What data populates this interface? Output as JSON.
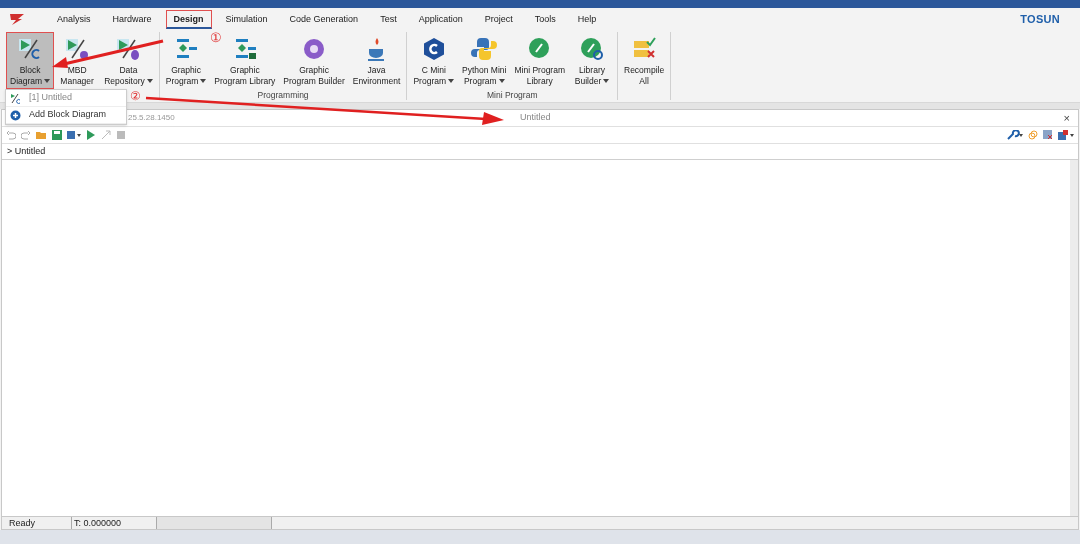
{
  "menu_tabs": [
    {
      "label": "Analysis",
      "selected": false,
      "highlighted": false
    },
    {
      "label": "Hardware",
      "selected": false,
      "highlighted": false
    },
    {
      "label": "Design",
      "selected": true,
      "highlighted": true
    },
    {
      "label": "Simulation",
      "selected": false,
      "highlighted": false
    },
    {
      "label": "Code Generation",
      "selected": false,
      "highlighted": false
    },
    {
      "label": "Test",
      "selected": false,
      "highlighted": false
    },
    {
      "label": "Application",
      "selected": false,
      "highlighted": false
    },
    {
      "label": "Project",
      "selected": false,
      "highlighted": false
    },
    {
      "label": "Tools",
      "selected": false,
      "highlighted": false
    },
    {
      "label": "Help",
      "selected": false,
      "highlighted": false
    }
  ],
  "brand": "TOSUN",
  "ribbon_groups": [
    {
      "items": [
        {
          "kind": "block",
          "lines": [
            "Block",
            "Diagram"
          ],
          "dropdown": true,
          "pressed": true
        },
        {
          "kind": "mbd",
          "lines": [
            "MBD",
            "Manager"
          ],
          "dropdown": false,
          "pressed": false
        },
        {
          "kind": "data",
          "lines": [
            "Data",
            "Repository"
          ],
          "dropdown": true,
          "pressed": false
        }
      ]
    },
    {
      "label": "Programming",
      "items": [
        {
          "kind": "graphic",
          "lines": [
            "Graphic",
            "Program"
          ],
          "dropdown": true,
          "pressed": false
        },
        {
          "kind": "graphiclib",
          "lines": [
            "Graphic",
            "Program Library"
          ],
          "dropdown": false,
          "pressed": false
        },
        {
          "kind": "builder",
          "lines": [
            "Graphic",
            "Program Builder"
          ],
          "dropdown": false,
          "pressed": false
        },
        {
          "kind": "java",
          "lines": [
            "Java",
            "Environment"
          ],
          "dropdown": false,
          "pressed": false
        }
      ]
    },
    {
      "label": "Mini Program",
      "items": [
        {
          "kind": "c",
          "lines": [
            "C Mini",
            "Program"
          ],
          "dropdown": true,
          "pressed": false
        },
        {
          "kind": "python",
          "lines": [
            "Python Mini",
            "Program"
          ],
          "dropdown": true,
          "pressed": false
        },
        {
          "kind": "mini",
          "lines": [
            "Mini Program",
            "Library"
          ],
          "dropdown": false,
          "pressed": false
        },
        {
          "kind": "libbuilder",
          "lines": [
            "Library",
            "Builder"
          ],
          "dropdown": true,
          "pressed": false
        }
      ]
    },
    {
      "items": [
        {
          "kind": "recompile",
          "lines": [
            "Recompile",
            "All"
          ],
          "dropdown": false,
          "pressed": false
        }
      ]
    }
  ],
  "dropdown_menu": [
    {
      "kind": "document",
      "label": "[1] Untitled",
      "disabled": true
    },
    {
      "kind": "add",
      "label": "Add Block Diagram",
      "disabled": false
    }
  ],
  "panel": {
    "version_fragment": "25.5.28.1450",
    "title": "Untitled",
    "close": "×",
    "tree_item": "> Untitled"
  },
  "status_bar": {
    "state": "Ready",
    "time": "T: 0.000000"
  },
  "annotations": [
    {
      "label": "①"
    },
    {
      "label": "②"
    }
  ]
}
